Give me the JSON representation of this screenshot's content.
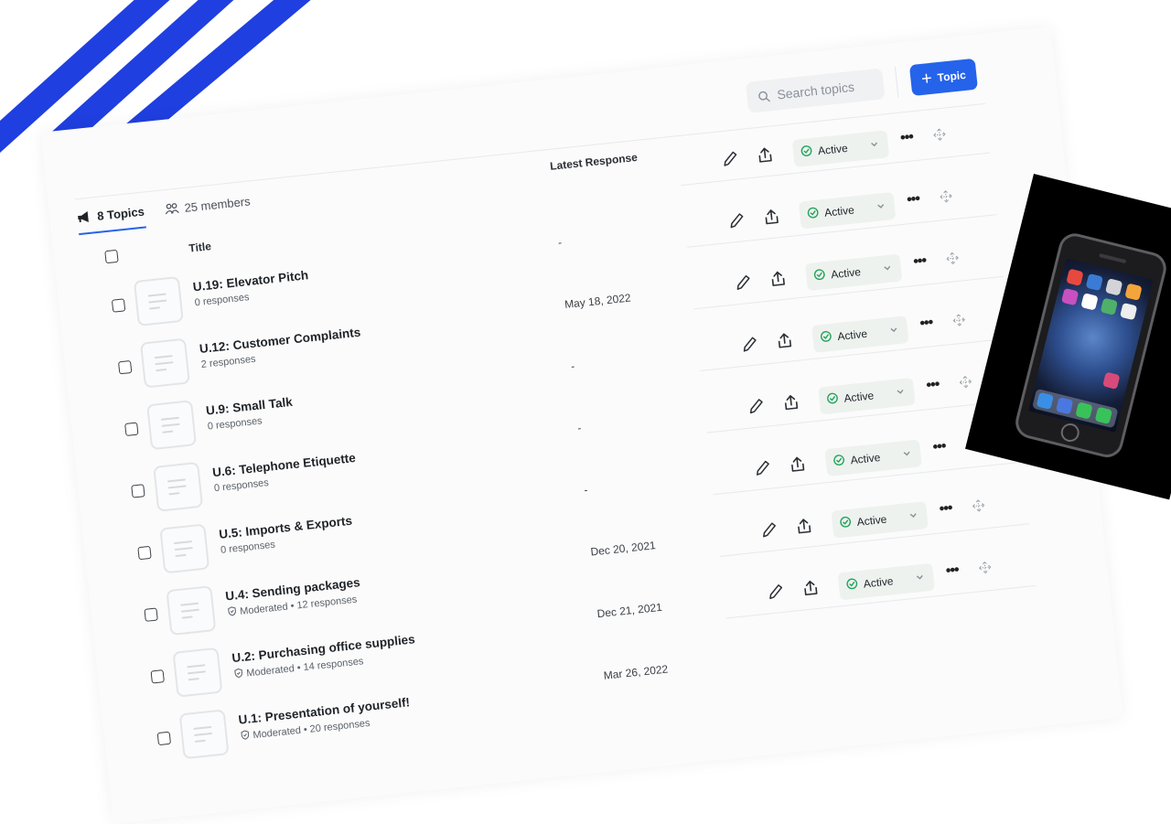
{
  "header": {
    "search_placeholder": "Search topics",
    "add_button_label": "Topic"
  },
  "tabs": [
    {
      "label": "8 Topics",
      "active": true,
      "icon": "megaphone-icon"
    },
    {
      "label": "25 members",
      "active": false,
      "icon": "members-icon"
    }
  ],
  "columns": {
    "title": "Title",
    "latest_response": "Latest Response"
  },
  "topics": [
    {
      "title": "U.19: Elevator Pitch",
      "meta": "0 responses",
      "moderated": false,
      "latest": "-",
      "status": "Active"
    },
    {
      "title": "U.12: Customer Complaints",
      "meta": "2 responses",
      "moderated": false,
      "latest": "May 18, 2022",
      "status": "Active"
    },
    {
      "title": "U.9: Small Talk",
      "meta": "0 responses",
      "moderated": false,
      "latest": "-",
      "status": "Active"
    },
    {
      "title": "U.6: Telephone Etiquette",
      "meta": "0 responses",
      "moderated": false,
      "latest": "-",
      "status": "Active"
    },
    {
      "title": "U.5: Imports & Exports",
      "meta": "0 responses",
      "moderated": false,
      "latest": "-",
      "status": "Active"
    },
    {
      "title": "U.4: Sending packages",
      "meta": "Moderated • 12 responses",
      "moderated": true,
      "latest": "Dec 20, 2021",
      "status": "Active"
    },
    {
      "title": "U.2: Purchasing office supplies",
      "meta": "Moderated • 14 responses",
      "moderated": true,
      "latest": "Dec 21, 2021",
      "status": "Active"
    },
    {
      "title": "U.1: Presentation of yourself!",
      "meta": "Moderated • 20 responses",
      "moderated": true,
      "latest": "Mar 26, 2022",
      "status": "Active"
    }
  ],
  "colors": {
    "accent": "#2563eb",
    "status_green": "#22a35a",
    "stripe_blue": "#1f3fe0",
    "stripe_green": "#0e7a62"
  }
}
